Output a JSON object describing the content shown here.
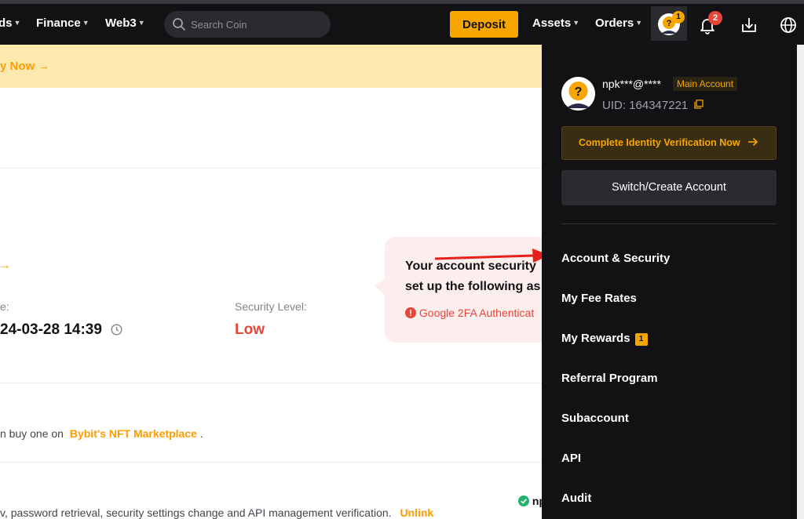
{
  "topbar": {
    "cut_label": "ds",
    "nav": [
      {
        "label": "Finance"
      },
      {
        "label": "Web3"
      }
    ],
    "search_placeholder": "Search Coin",
    "deposit_label": "Deposit",
    "assets_label": "Assets",
    "orders_label": "Orders",
    "profile_badge": "1",
    "notif_badge": "2",
    "icons": [
      "search-icon",
      "avatar-icon",
      "bell-icon",
      "download-icon",
      "globe-icon"
    ]
  },
  "banner": {
    "link_text": "y Now →"
  },
  "security": {
    "cut_date_label": "e:",
    "date_value": "24-03-28 14:39",
    "level_label": "Security Level:",
    "level_value": "Low",
    "tooltip_line1": "Your account security",
    "tooltip_line2": "set up the following as",
    "tooltip_item": "Google 2FA Authenticat",
    "arrow_glyph": "→"
  },
  "nft": {
    "prefix": "n buy one on",
    "link": "Bybit's NFT Marketplace",
    "suffix": "."
  },
  "bottom_row": {
    "text": "v, password retrieval, security settings change and API management verification.",
    "unlink": "Unlink",
    "cut_status": "np"
  },
  "panel": {
    "username": "npk***@****",
    "main_tag": "Main Account",
    "uid": "UID: 164347221",
    "verify_label": "Complete Identity Verification Now",
    "switch_label": "Switch/Create Account",
    "menu": [
      {
        "label": "Account & Security"
      },
      {
        "label": "My Fee Rates"
      },
      {
        "label": "My Rewards",
        "badge": "1"
      },
      {
        "label": "Referral Program"
      },
      {
        "label": "Subaccount"
      },
      {
        "label": "API"
      },
      {
        "label": "Audit"
      }
    ]
  },
  "colors": {
    "accent": "#f7a600",
    "danger": "#e7453a",
    "panel_bg": "#121214",
    "banner_bg": "#fde9ae"
  }
}
